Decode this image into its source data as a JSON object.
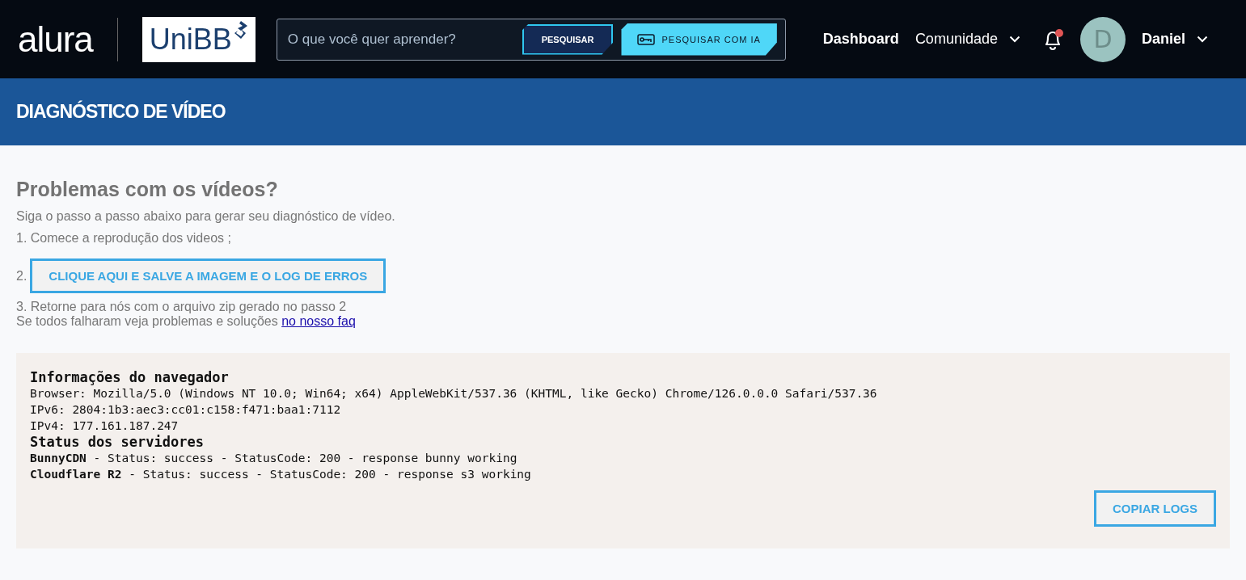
{
  "header": {
    "logo": "alura",
    "partner_logo": "UniBB",
    "search": {
      "placeholder": "O que você quer aprender?",
      "button": "PESQUISAR",
      "ai_button": "PESQUISAR COM IA"
    },
    "nav": [
      {
        "label": "Dashboard",
        "kind": "link"
      },
      {
        "label": "Comunidade",
        "kind": "dropdown"
      }
    ],
    "notifications": {
      "unread": true
    },
    "user": {
      "initial": "D",
      "name": "Daniel"
    }
  },
  "banner": {
    "title": "DIAGNÓSTICO DE VÍDEO"
  },
  "intro": {
    "heading": "Problemas com os vídeos?",
    "subtitle": "Siga o passo a passo abaixo para gerar seu diagnóstico de vídeo.",
    "step1": "1. Comece a reprodução dos videos ;",
    "step2_number": "2.",
    "step2_button": "CLIQUE AQUI E SALVE A IMAGEM E O LOG DE ERROS",
    "step3": "3. Retorne para nós com o arquivo zip gerado no passo 2",
    "faq_text": "Se todos falharam veja problemas e soluções",
    "faq_link": "no nosso faq"
  },
  "log": {
    "browser_heading": "Informações do navegador",
    "browser_lines": [
      "Browser: Mozilla/5.0 (Windows NT 10.0; Win64; x64) AppleWebKit/537.36 (KHTML, like Gecko) Chrome/126.0.0.0 Safari/537.36",
      "IPv6: 2804:1b3:aec3:cc01:c158:f471:baa1:7112",
      "IPv4: 177.161.187.247"
    ],
    "servers_heading": "Status dos servidores",
    "server_lines": [
      "**BunnyCDN** - Status: success - StatusCode: 200 - response bunny working",
      "**Cloudflare R2** - Status: success - StatusCode: 200 - response s3 working"
    ],
    "copy_button": "COPIAR LOGS"
  }
}
